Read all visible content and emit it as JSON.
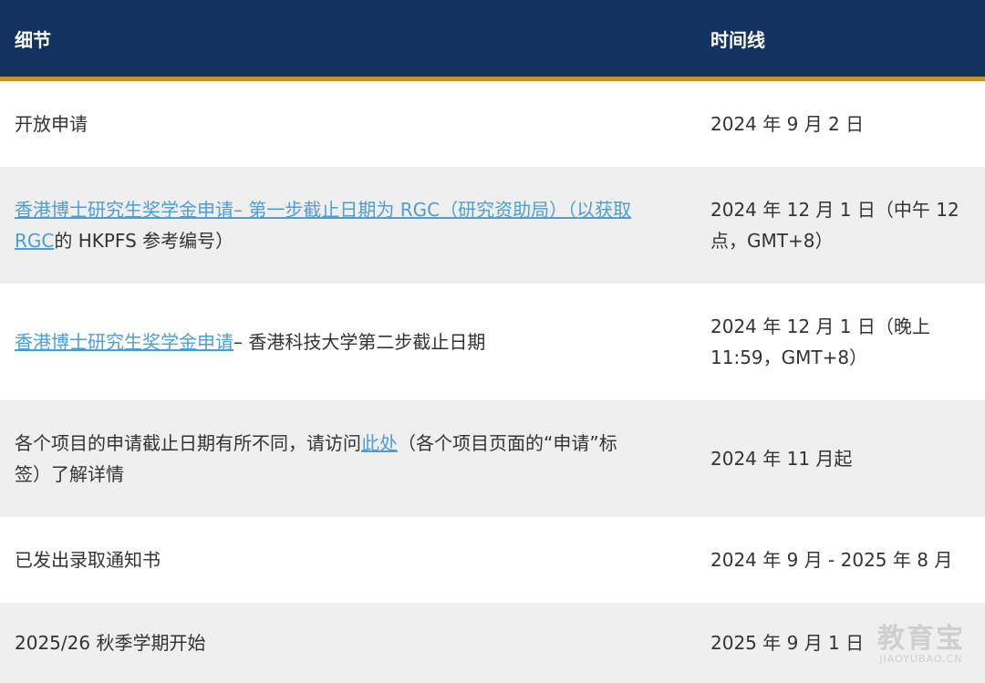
{
  "header": {
    "detail_label": "细节",
    "time_label": "时间线"
  },
  "rows": [
    {
      "detail_text": "开放申请",
      "time": "2024 年 9 月 2 日"
    },
    {
      "detail_link": "香港博士研究生奖学金申请– 第一步截止日期为 RGC（研究资助局）（以获取RGC",
      "detail_suffix": "的 HKPFS 参考编号）",
      "time": "2024 年 12 月 1 日（中午 12 点，GMT+8）"
    },
    {
      "detail_link": "香港博士研究生奖学金申请",
      "detail_suffix": "– 香港科技大学第二步截止日期",
      "time": "2024 年 12 月 1 日（晚上 11:59，GMT+8）"
    },
    {
      "detail_prefix": "各个项目的申请截止日期有所不同，请访问",
      "detail_link": "此处",
      "detail_suffix": "（各个项目页面的“申请”标签）了解详情",
      "time": "2024 年 11 月起"
    },
    {
      "detail_text": "已发出录取通知书",
      "time": "2024 年 9 月 - 2025 年 8 月"
    },
    {
      "detail_text": "2025/26 秋季学期开始",
      "time": "2025 年 9 月 1 日"
    }
  ],
  "watermark": {
    "main": "教育宝",
    "sub": "JIAOYUBAO.CN"
  },
  "colors": {
    "header_bg": "#12325f",
    "header_border": "#c5922e",
    "link": "#4a9fd6",
    "row_alt": "#efefef"
  }
}
